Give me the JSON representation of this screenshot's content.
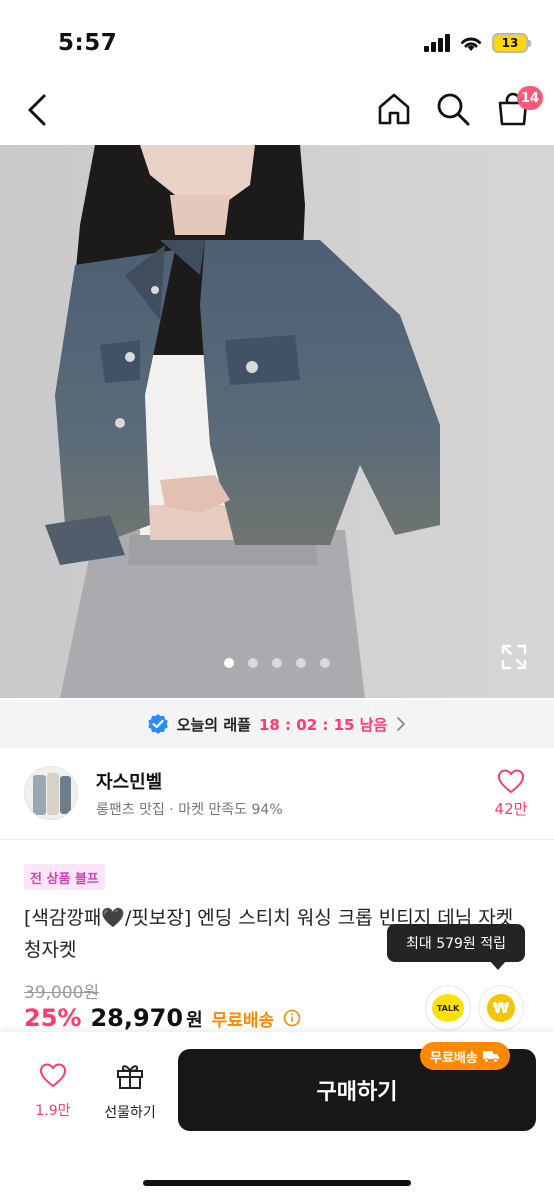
{
  "status_bar": {
    "time": "5:57",
    "battery": "13"
  },
  "nav": {
    "cart_badge": "14"
  },
  "gallery": {
    "dot_count": 5,
    "active_index": 0
  },
  "raffle": {
    "label": "오늘의 래플",
    "countdown": "18 : 02 : 15 남음"
  },
  "shop": {
    "name": "자스민벨",
    "description": "롱팬츠 맛집 · 마켓 만족도 94%",
    "like_count": "42만"
  },
  "product": {
    "promo_badge": "전 상품 블프",
    "title": "[색감깡패🖤/핏보장] 엔딩 스티치 워싱 크롭 빈티지 데님 자켓 청자켓",
    "tooltip": "최대 579원 적립",
    "original_price": "39,000원",
    "discount": "25%",
    "price": "28,970",
    "currency": "원",
    "shipping": "무료배송",
    "talk_label": "TALK",
    "point_symbol": "₩"
  },
  "bottom_bar": {
    "like_count": "1.9만",
    "gift_label": "선물하기",
    "buy_label": "구매하기",
    "shipping_chip": "무료배송"
  },
  "colors": {
    "accent_pink": "#ff3b6b",
    "shipping_orange": "#ff8a00",
    "buy_button": "#171717",
    "badge_pink": "#ff5a7a",
    "verified_blue": "#2a8cff"
  }
}
